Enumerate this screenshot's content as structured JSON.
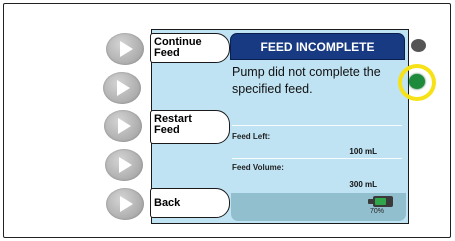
{
  "soft_keys": {
    "continue_feed": "Continue\nFeed",
    "restart_feed": "Restart\nFeed",
    "back": "Back"
  },
  "header": {
    "title": "FEED INCOMPLETE"
  },
  "message": "Pump did not complete the specified feed.",
  "fields": {
    "feed_left_label": "Feed Left:",
    "feed_left_value": "100 mL",
    "feed_volume_label": "Feed Volume:",
    "feed_volume_value": "300 mL"
  },
  "battery": {
    "percent_text": "70%",
    "level": 0.7
  },
  "colors": {
    "header": "#173a82",
    "screen": "#c0e3f4",
    "status_led": "#1e8a3c",
    "highlight": "#f6e217"
  },
  "icons": {
    "side_buttons": "play-triangle-icon",
    "battery": "battery-icon",
    "power_led": "led-indicator-icon"
  }
}
